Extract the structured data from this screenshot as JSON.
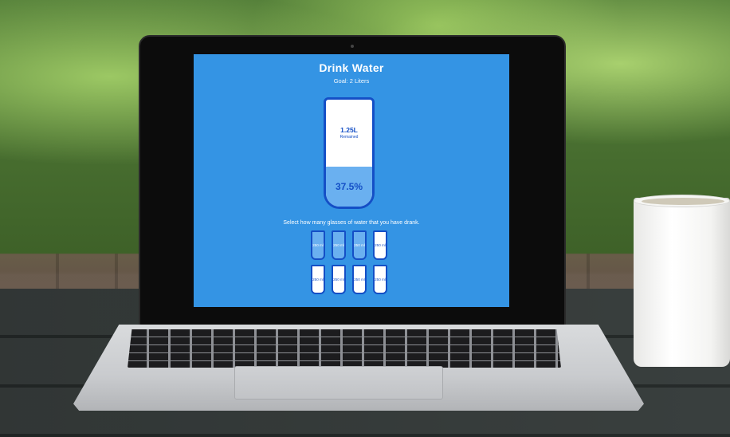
{
  "app": {
    "title": "Drink Water",
    "goal": "Goal: 2 Liters"
  },
  "cup": {
    "remained_amount": "1.25L",
    "remained_label": "Remained",
    "percentage": "37.5%",
    "fill_fraction": 0.375
  },
  "instruction": "Select how many glasses of water that you have drank.",
  "glasses": [
    {
      "label": "250 ml",
      "full": true
    },
    {
      "label": "250 ml",
      "full": true
    },
    {
      "label": "250 ml",
      "full": true
    },
    {
      "label": "250 ml",
      "full": false
    },
    {
      "label": "250 ml",
      "full": false
    },
    {
      "label": "250 ml",
      "full": false
    },
    {
      "label": "250 ml",
      "full": false
    },
    {
      "label": "250 ml",
      "full": false
    }
  ],
  "colors": {
    "background": "#3494e4",
    "accent": "#144fc6",
    "fill": "#6ab0f0"
  }
}
